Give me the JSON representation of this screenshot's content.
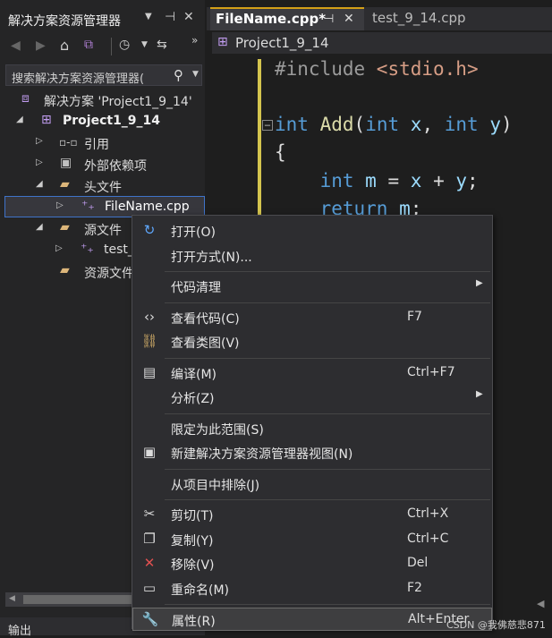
{
  "solution_explorer": {
    "title": "解决方案资源管理器",
    "title_icons": [
      "dropdown-icon",
      "pin-icon",
      "close-icon"
    ],
    "search_placeholder": "搜索解决方案资源管理器(",
    "tree": [
      {
        "label": "解决方案 'Project1_9_14'",
        "icon": "solution-icon"
      },
      {
        "label": "Project1_9_14",
        "icon": "project-icon",
        "bold": true
      },
      {
        "label": "引用",
        "icon": "references-icon"
      },
      {
        "label": "外部依赖项",
        "icon": "external-deps-icon"
      },
      {
        "label": "头文件",
        "icon": "filter-folder-icon"
      },
      {
        "label": "FileName.cpp",
        "icon": "cpp-file-icon"
      },
      {
        "label": "源文件",
        "icon": "filter-folder-icon"
      },
      {
        "label": "test_",
        "icon": "cpp-file-icon"
      },
      {
        "label": "资源文件",
        "icon": "filter-folder-icon"
      }
    ]
  },
  "output_tab": "输出",
  "editor": {
    "tabs": [
      {
        "label": "FileName.cpp*",
        "active": true
      },
      {
        "label": "test_9_14.cpp",
        "active": false
      }
    ],
    "breadcrumb": "Project1_9_14",
    "code_lines": [
      {
        "parts": [
          [
            "pp",
            "#include "
          ],
          [
            "st",
            "<stdio.h>"
          ]
        ]
      },
      {
        "parts": [
          [
            "kw",
            "int"
          ],
          [
            "pl",
            " "
          ],
          [
            "fn",
            "Add"
          ],
          [
            "pl",
            "("
          ],
          [
            "kw",
            "int"
          ],
          [
            "pl",
            " "
          ],
          [
            "vr",
            "x"
          ],
          [
            "pl",
            ", "
          ],
          [
            "kw",
            "int"
          ],
          [
            "pl",
            " "
          ],
          [
            "vr",
            "y"
          ],
          [
            "pl",
            ")"
          ]
        ]
      },
      {
        "parts": [
          [
            "pl",
            "{"
          ]
        ]
      },
      {
        "parts": [
          [
            "pl",
            "    "
          ],
          [
            "kw",
            "int"
          ],
          [
            "pl",
            " "
          ],
          [
            "vr",
            "m"
          ],
          [
            "pl",
            " = "
          ],
          [
            "vr",
            "x"
          ],
          [
            "pl",
            " + "
          ],
          [
            "vr",
            "y"
          ],
          [
            "pl",
            ";"
          ]
        ]
      },
      {
        "parts": [
          [
            "pl",
            "    "
          ],
          [
            "kw",
            "return"
          ],
          [
            "pl",
            " "
          ],
          [
            "vr",
            "m"
          ],
          [
            "pl",
            ";"
          ]
        ]
      }
    ]
  },
  "context_menu": {
    "items": [
      {
        "icon": "open-icon",
        "label": "打开(O)",
        "shortcut": ""
      },
      {
        "icon": "",
        "label": "打开方式(N)...",
        "shortcut": ""
      },
      {
        "sep": true
      },
      {
        "icon": "",
        "label": "代码清理",
        "shortcut": "",
        "submenu": true
      },
      {
        "sep": true
      },
      {
        "icon": "view-code-icon",
        "label": "查看代码(C)",
        "shortcut": "F7"
      },
      {
        "icon": "class-diagram-icon",
        "label": "查看类图(V)",
        "shortcut": ""
      },
      {
        "sep": true
      },
      {
        "icon": "compile-icon",
        "label": "编译(M)",
        "shortcut": "Ctrl+F7"
      },
      {
        "icon": "",
        "label": "分析(Z)",
        "shortcut": "",
        "submenu": true
      },
      {
        "sep": true
      },
      {
        "icon": "",
        "label": "限定为此范围(S)",
        "shortcut": ""
      },
      {
        "icon": "new-view-icon",
        "label": "新建解决方案资源管理器视图(N)",
        "shortcut": ""
      },
      {
        "sep": true
      },
      {
        "icon": "",
        "label": "从项目中排除(J)",
        "shortcut": ""
      },
      {
        "sep": true
      },
      {
        "icon": "cut-icon",
        "label": "剪切(T)",
        "shortcut": "Ctrl+X"
      },
      {
        "icon": "copy-icon",
        "label": "复制(Y)",
        "shortcut": "Ctrl+C"
      },
      {
        "icon": "remove-icon",
        "label": "移除(V)",
        "shortcut": "Del"
      },
      {
        "icon": "rename-icon",
        "label": "重命名(M)",
        "shortcut": "F2"
      },
      {
        "sep": true
      },
      {
        "icon": "properties-icon",
        "label": "属性(R)",
        "shortcut": "Alt+Enter",
        "highlighted": true
      }
    ]
  },
  "watermark": "CSDN @我佛慈悲871",
  "colors": {
    "accent": "#3f73c9",
    "active_tab_border": "#d4a017",
    "remove_icon": "#e05050"
  }
}
